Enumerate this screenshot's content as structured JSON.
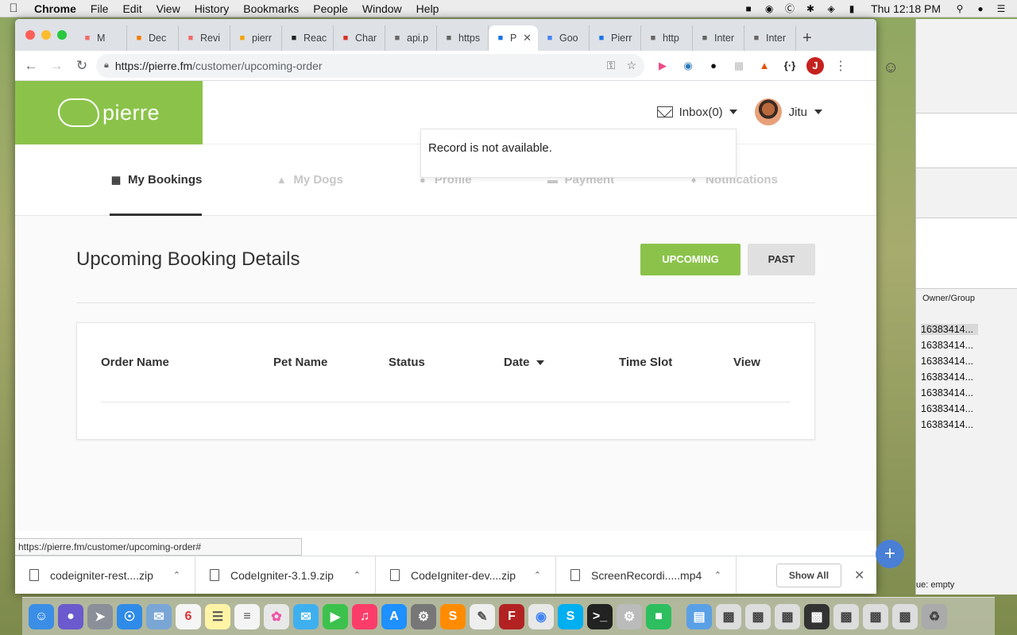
{
  "menubar": {
    "items": [
      "Chrome",
      "File",
      "Edit",
      "View",
      "History",
      "Bookmarks",
      "People",
      "Window",
      "Help"
    ],
    "clock": "Thu 12:18 PM"
  },
  "tabs": [
    {
      "label": "M",
      "icon": "asana-icon",
      "color": "#f06a6a"
    },
    {
      "label": "Dec",
      "icon": "play-icon",
      "color": "#f57c00"
    },
    {
      "label": "Revi",
      "icon": "asana-icon",
      "color": "#f06a6a"
    },
    {
      "label": "pierr",
      "icon": "pma-icon",
      "color": "#f4a300"
    },
    {
      "label": "Reac",
      "icon": "react-icon",
      "color": "#222"
    },
    {
      "label": "Char",
      "icon": "gmail-icon",
      "color": "#d93025"
    },
    {
      "label": "api.p",
      "icon": "page-icon",
      "color": "#666"
    },
    {
      "label": "https",
      "icon": "page-icon",
      "color": "#666"
    },
    {
      "label": "P",
      "icon": "ps-icon",
      "color": "#1a73e8",
      "active": true
    },
    {
      "label": "Goo",
      "icon": "translate-icon",
      "color": "#4285f4"
    },
    {
      "label": "Pierr",
      "icon": "ps-icon",
      "color": "#1a73e8"
    },
    {
      "label": "http",
      "icon": "page-icon",
      "color": "#666"
    },
    {
      "label": "Inter",
      "icon": "page-icon",
      "color": "#666"
    },
    {
      "label": "Inter",
      "icon": "page-icon",
      "color": "#666"
    }
  ],
  "omnibox": {
    "scheme": "https://",
    "host": "pierre.fm",
    "path": "/customer/upcoming-order"
  },
  "profile_initial": "J",
  "site": {
    "logo_text": "pierre",
    "inbox_label": "Inbox(0)",
    "user_name": "Jitu",
    "toast": "Record is not available.",
    "nav": [
      {
        "label": "My Bookings",
        "icon": "calendar-icon",
        "active": true
      },
      {
        "label": "My Dogs",
        "icon": "dog-icon"
      },
      {
        "label": "Profile",
        "icon": "user-icon"
      },
      {
        "label": "Payment",
        "icon": "card-icon"
      },
      {
        "label": "Notifications",
        "icon": "bell-icon"
      }
    ],
    "page_title": "Upcoming Booking Details",
    "btn_upcoming": "UPCOMING",
    "btn_past": "PAST",
    "columns": [
      "Order Name",
      "Pet Name",
      "Status",
      "Date",
      "Time Slot",
      "View"
    ]
  },
  "status_url": "https://pierre.fm/customer/upcoming-order#",
  "downloads": [
    "codeigniter-rest....zip",
    "CodeIgniter-3.1.9.zip",
    "CodeIgniter-dev....zip",
    "ScreenRecordi.....mp4"
  ],
  "show_all": "Show All",
  "bg_app": {
    "owner_header": "Owner/Group",
    "rows": [
      "16383414...",
      "16383414...",
      "16383414...",
      "16383414...",
      "16383414...",
      "16383414...",
      "16383414..."
    ],
    "status": "ue: empty"
  }
}
